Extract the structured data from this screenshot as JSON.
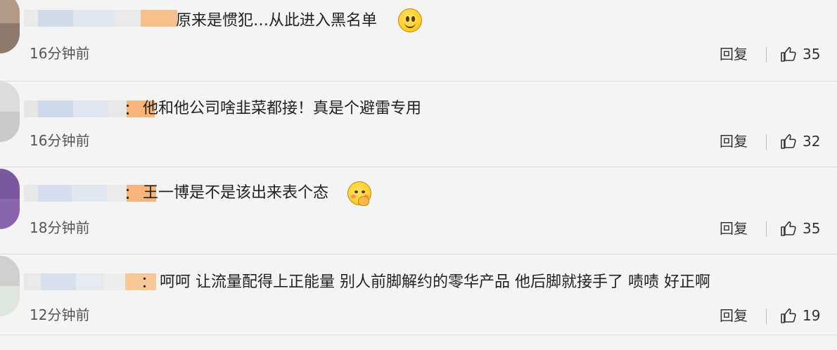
{
  "comments": [
    {
      "avatar_colors": [
        "#b39a86",
        "#8c7a6c"
      ],
      "username_blur": [
        "#eaeaea",
        "#d2dbe9",
        "#e3e8f0",
        "#e9e9e9",
        "#f6c08d"
      ],
      "colon": "",
      "text": "原来是惯犯…从此进入黑名单",
      "emoji": "smile-emoji",
      "time": "16分钟前",
      "reply": "回复",
      "likes": "35"
    },
    {
      "avatar_colors": [
        "#dcdcdc",
        "#c9c9c9"
      ],
      "username_blur": [
        "#e6e6e6",
        "#cdd8ea",
        "#dfe6f0",
        "#e8e8e8",
        "#f7b57a"
      ],
      "colon": "：",
      "text": "他和他公司啥韭菜都接！真是个避雷专用",
      "emoji": "",
      "time": "16分钟前",
      "reply": "回复",
      "likes": "32"
    },
    {
      "avatar_colors": [
        "#7a58a0",
        "#8a64ad"
      ],
      "username_blur": [
        "#e8e8e8",
        "#d4deee",
        "#e1e7f0",
        "#ececec",
        "#f6b57c"
      ],
      "colon": "：",
      "text": "王一博是不是该出来表个态",
      "emoji": "hand-on-cheek-emoji",
      "time": "18分钟前",
      "reply": "回复",
      "likes": "35"
    },
    {
      "avatar_colors": [
        "#cfcfcf",
        "#dfe6e0"
      ],
      "username_blur": [
        "#e9e9e9",
        "#d6e0ee",
        "#e5eaf1",
        "#ededed",
        "#f8c996"
      ],
      "colon": "：",
      "text": "呵呵 让流量配得上正能量 别人前脚解约的零华产品 他后脚就接手了 啧啧 好正啊",
      "emoji": "",
      "time": "12分钟前",
      "reply": "回复",
      "likes": "19"
    }
  ]
}
